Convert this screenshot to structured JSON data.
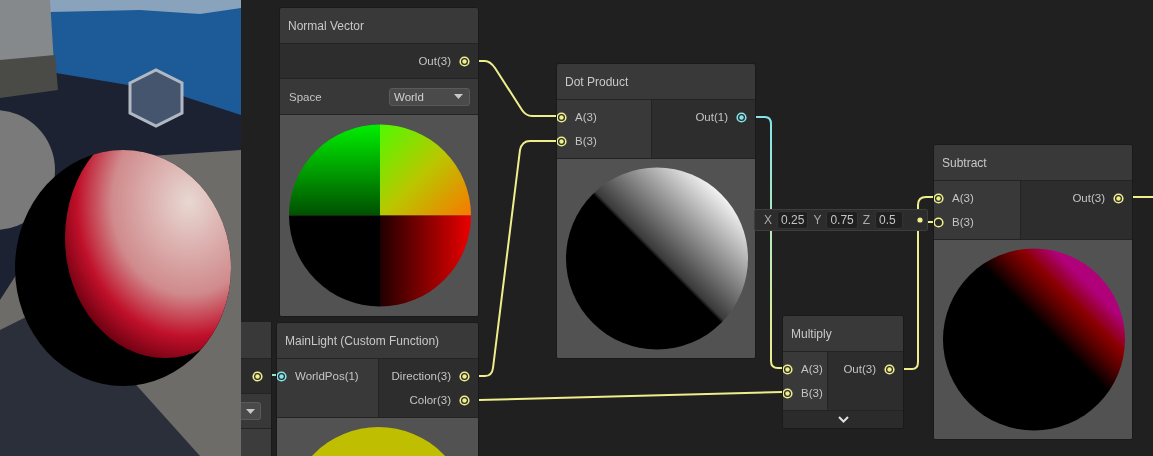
{
  "nodes": [
    {
      "title": "Normal Vector",
      "outputs": [
        {
          "label": "Out(3)",
          "color": "#eeee8c",
          "connected": true
        }
      ],
      "controls": [
        {
          "label": "Space",
          "value": "World"
        }
      ],
      "preview": {
        "kind": "normals"
      }
    },
    {
      "title": "Dot Product",
      "inputs": [
        {
          "label": "A(3)",
          "color": "#eeee8c",
          "connected": true
        },
        {
          "label": "B(3)",
          "color": "#eeee8c",
          "connected": true
        }
      ],
      "outputs": [
        {
          "label": "Out(1)",
          "color": "#84e4e7",
          "connected": true
        }
      ],
      "preview": {
        "kind": "dot"
      }
    },
    {
      "title": "MainLight (Custom Function)",
      "inputs": [
        {
          "label": "WorldPos(1)",
          "color": "#84e4e7",
          "connected": true
        }
      ],
      "outputs": [
        {
          "label": "Direction(3)",
          "color": "#eeee8c",
          "connected": true
        },
        {
          "label": "Color(3)",
          "color": "#eeee8c",
          "connected": true
        }
      ],
      "preview": {
        "kind": "solid"
      }
    },
    {
      "title": "Multiply",
      "inputs": [
        {
          "label": "A(3)",
          "color": "#eeee8c",
          "connected": true
        },
        {
          "label": "B(3)",
          "color": "#eeee8c",
          "connected": true
        }
      ],
      "outputs": [
        {
          "label": "Out(3)",
          "color": "#eeee8c",
          "connected": true
        }
      ],
      "preview": {
        "kind": "collapsed"
      }
    },
    {
      "title": "Subtract",
      "inputs": [
        {
          "label": "A(3)",
          "color": "#eeee8c",
          "connected": true
        },
        {
          "label": "B(3)",
          "color": "#eeee8c",
          "connected": false
        }
      ],
      "outputs": [
        {
          "label": "Out(3)",
          "color": "#eeee8c",
          "connected": true
        }
      ],
      "preview": {
        "kind": "subtract"
      }
    }
  ],
  "inline_input": {
    "fields": [
      {
        "label": "X",
        "value": "0.25"
      },
      {
        "label": "Y",
        "value": "0.75"
      },
      {
        "label": "Z",
        "value": "0.5"
      }
    ]
  }
}
